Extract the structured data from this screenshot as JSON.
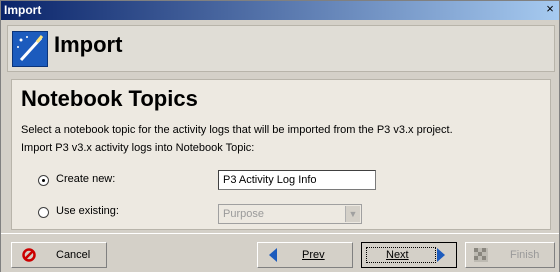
{
  "window": {
    "title": "Import",
    "close_label": "×"
  },
  "header": {
    "title": "Import",
    "icon": "wand-icon"
  },
  "page": {
    "title": "Notebook Topics",
    "description": "Select a notebook topic for the activity logs that will be imported from the P3 v3.x project.",
    "instruction": "Import P3 v3.x activity logs into Notebook Topic:"
  },
  "options": {
    "create_new": {
      "label": "Create new:",
      "selected": true,
      "value": "P3 Activity Log Info"
    },
    "use_existing": {
      "label": "Use existing:",
      "selected": false,
      "value": "Purpose",
      "enabled": false
    }
  },
  "buttons": {
    "cancel": "Cancel",
    "prev": "Prev",
    "next": "Next",
    "finish": "Finish"
  },
  "colors": {
    "titlebar_start": "#0a246a",
    "titlebar_end": "#a6caf0",
    "nav_arrow": "#1c5bbd",
    "cancel_icon": "#cc0000"
  }
}
